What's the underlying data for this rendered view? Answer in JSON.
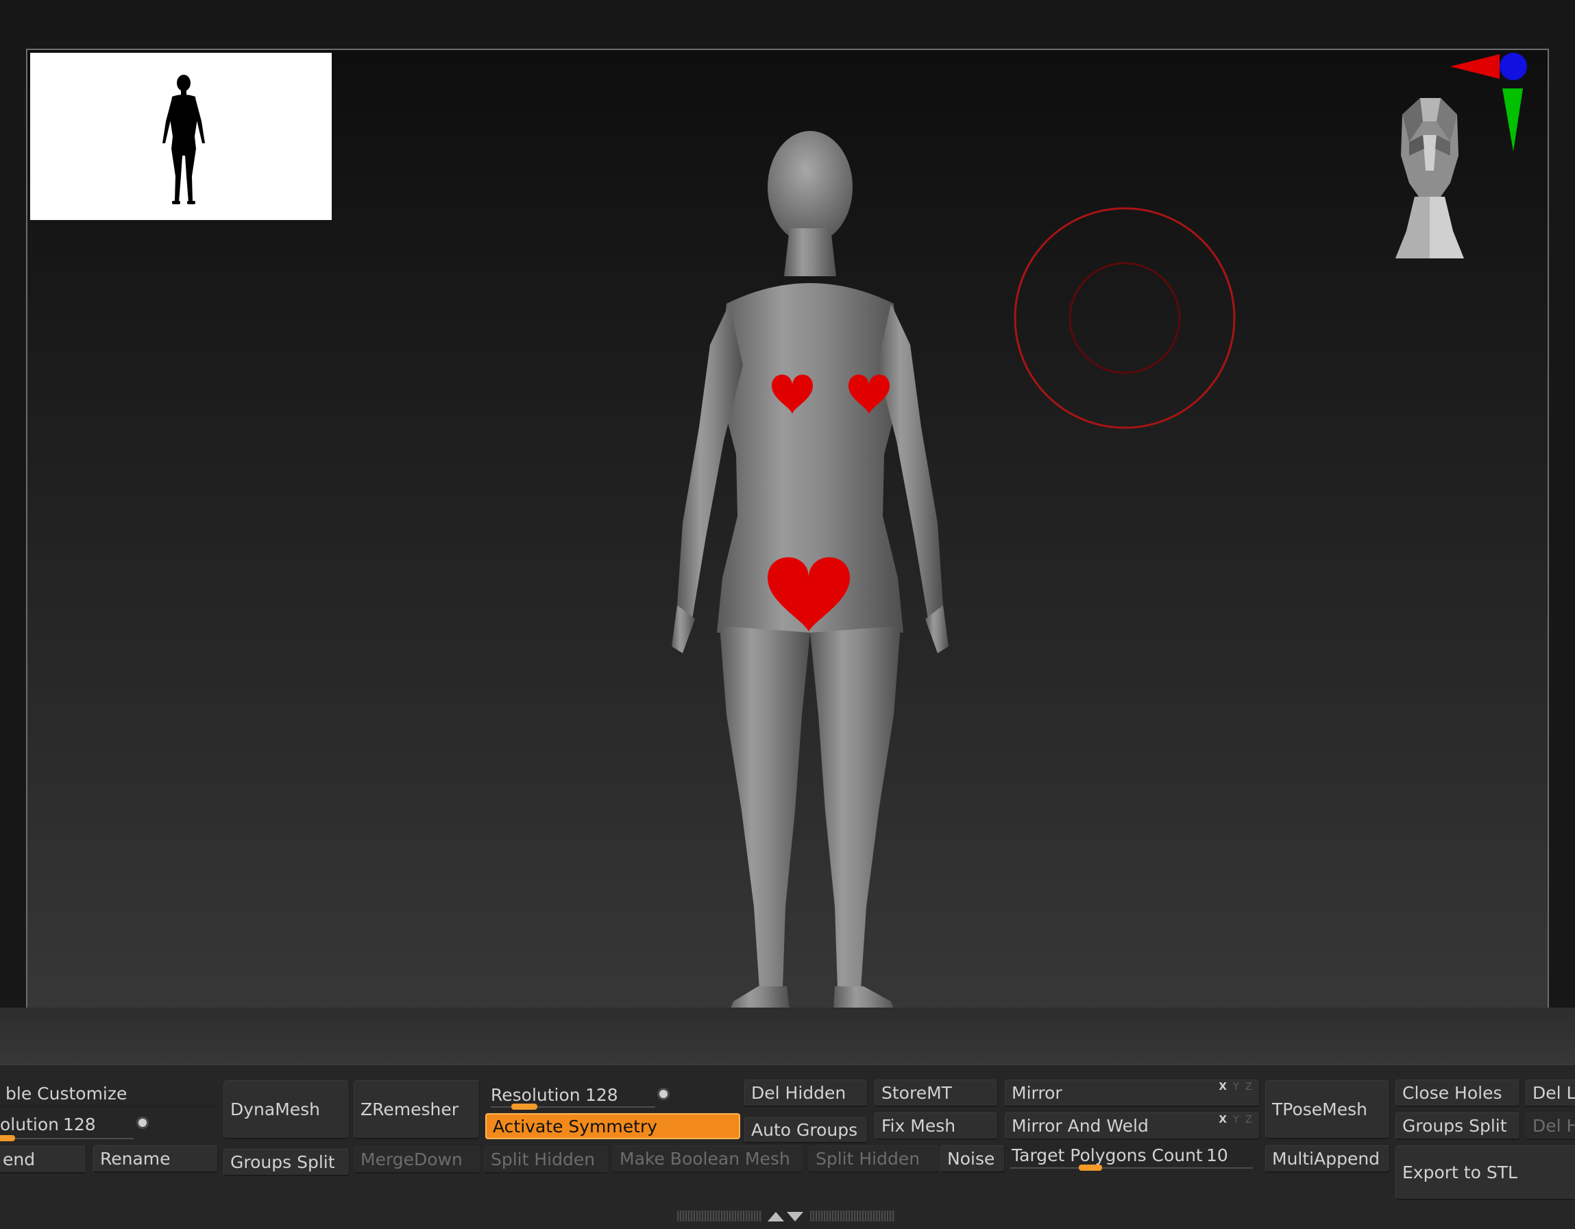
{
  "canvas": {
    "thumbnail": {
      "name": "figure-silhouette"
    },
    "model": {
      "name": "female-base-mesh"
    },
    "censor_marks": {
      "color": "#e00000"
    },
    "gizmo": {
      "x_color": "#e00000",
      "y_color": "#00c000",
      "z_color": "#1010e0"
    },
    "brush_cursor": {
      "color": "#a01010"
    }
  },
  "shelf": {
    "col1": {
      "customize_label": "ble Customize",
      "resolution_label": "olution",
      "resolution_value": "128",
      "append_label": "end",
      "rename_label": "Rename"
    },
    "dynamesh_label": "DynaMesh",
    "groups_split_label": "Groups Split",
    "zremesher_label": "ZRemesher",
    "mergedown_label": "MergeDown",
    "resolution": {
      "label": "Resolution",
      "value": "128",
      "fraction": 0.25
    },
    "activate_symmetry_label": "Activate Symmetry",
    "split_hidden_label": "Split Hidden",
    "make_boolean_label": "Make Boolean Mesh",
    "del_hidden_label": "Del Hidden",
    "auto_groups_label": "Auto Groups",
    "split_hidden2_label": "Split Hidden",
    "storemt_label": "StoreMT",
    "fix_mesh_label": "Fix Mesh",
    "noise_label": "Noise",
    "mirror": {
      "label": "Mirror",
      "axes": [
        "X",
        "Y",
        "Z"
      ]
    },
    "mirror_weld": {
      "label": "Mirror And Weld",
      "axes": [
        "X",
        "Y",
        "Z"
      ]
    },
    "target_polygons": {
      "label": "Target Polygons Count",
      "value": "10",
      "fraction": 0.3
    },
    "tposemesh_label": "TPoseMesh",
    "multiappend_label": "MultiAppend",
    "close_holes_label": "Close Holes",
    "groups_split2_label": "Groups Split",
    "export_stl_label": "Export to STL",
    "del_lower_label": "Del Lo",
    "del_higher_label": "Del H"
  },
  "colors": {
    "accent": "#f28a1b",
    "panel": "#262626",
    "button": "#2f2f2f"
  }
}
